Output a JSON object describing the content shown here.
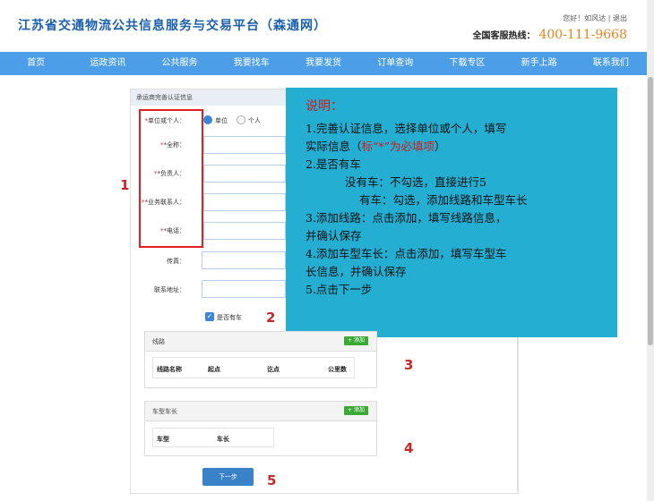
{
  "header": {
    "site_title": "江苏省交通物流公共信息服务与交易平台（森通网）",
    "user_links": "您好！如风达 | 退出",
    "hotline_label": "全国客服热线：",
    "hotline_number": "400-111-9668"
  },
  "nav": [
    "首页",
    "运政资讯",
    "公共服务",
    "我要找车",
    "我要发货",
    "订单查询",
    "下载专区",
    "新手上路",
    "联系我们"
  ],
  "form": {
    "header": "承运商完善认证信息",
    "fields": {
      "unit_or_person": "单位或个人：",
      "full_name": "*全称：",
      "principal": "*负责人：",
      "contact": "*业务联系人：",
      "phone": "*电话：",
      "fax": "传真：",
      "address": "联系地址："
    },
    "options": {
      "unit": "单位",
      "person": "个人"
    },
    "has_car": "是否有车",
    "route_section": {
      "title": "线路",
      "add": "添加",
      "columns": [
        "线路名称",
        "起点",
        "讫点",
        "公里数"
      ]
    },
    "vehicle_section": {
      "title": "车型车长",
      "add": "添加",
      "columns": [
        "车型",
        "车长"
      ]
    },
    "next_button": "下一步"
  },
  "callout": {
    "title": "说明：",
    "line1": "1.完善认证信息，选择单位或个人，填写",
    "line2a": "实际信息（",
    "line2b": "标“*”为必填项",
    "line2c": "）",
    "line3": "2.是否有车",
    "line4": "没有车：不勾选，直接进行5",
    "line5": "有车：勾选，添加线路和车型车长",
    "line6": "3.添加线路：点击添加，填写线路信息，",
    "line7": "并确认保存",
    "line8": "4.添加车型车长：点击添加，填写车型车",
    "line9": "长信息，并确认保存",
    "line10": "5.点击下一步"
  },
  "annotations": [
    "1",
    "2",
    "3",
    "4",
    "5"
  ],
  "colors": {
    "nav_bg": "#4d9ee8",
    "callout_bg": "#23aed2",
    "highlight_red": "#e02020",
    "hotline_orange": "#e8821e"
  }
}
